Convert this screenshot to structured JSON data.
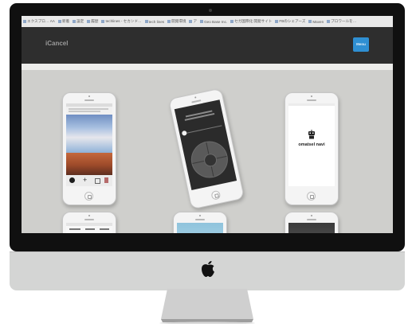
{
  "browser": {
    "bookmarks": [
      {
        "label": "エクスプロ… AA"
      },
      {
        "label": "新着"
      },
      {
        "label": "設定"
      },
      {
        "label": "履歴"
      },
      {
        "label": "techlines - セカンド…"
      },
      {
        "label": "tech lines"
      },
      {
        "label": "開発環境"
      },
      {
        "label": "ア"
      },
      {
        "label": "Geo Base Inc."
      },
      {
        "label": "セガ国際化 開発サイト"
      },
      {
        "label": "FBのシェアーズ"
      },
      {
        "label": "Maven"
      },
      {
        "label": "プロワールを…"
      }
    ]
  },
  "site": {
    "brand": "iCancel",
    "nav_button": "Menu"
  },
  "phones": {
    "three": {
      "app_name": "omatsel navi"
    }
  },
  "colors": {
    "accent": "#2f8fd2",
    "navbar": "#2e2e2e",
    "content_bg": "#cfcfcc"
  }
}
